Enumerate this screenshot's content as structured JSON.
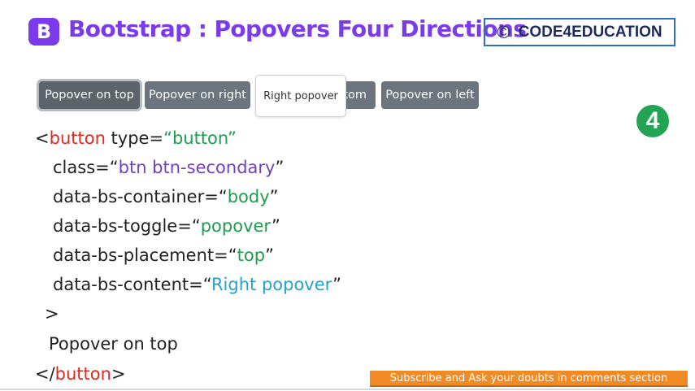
{
  "header": {
    "logo_letter": "B",
    "title": "Bootstrap : Popovers Four Directions",
    "brand": {
      "symbol": "©",
      "name": "CODE4EDUCATION"
    }
  },
  "buttons": [
    {
      "label": "Popover on top"
    },
    {
      "label": "Popover on right"
    },
    {
      "label": "Popover on bottom"
    },
    {
      "label": "Popover on left"
    }
  ],
  "popover": {
    "text": "Right popover"
  },
  "watermark": {
    "glyph": "4"
  },
  "code": {
    "open_lt": "<",
    "open_tag": "button",
    "type_attr": " type=",
    "type_val": "“button”",
    "class_attr": "class=",
    "class_q1": "“",
    "class_val": "btn btn-secondary",
    "class_q2": "”",
    "container_attr": "data-bs-container=",
    "container_q1": "“",
    "container_val": "body",
    "container_q2": "”",
    "toggle_attr": "data-bs-toggle=",
    "toggle_q1": "“",
    "toggle_val": "popover",
    "toggle_q2": "”",
    "placement_attr": "data-bs-placement=",
    "placement_q1": "“",
    "placement_val": "top",
    "placement_q2": "”",
    "content_attr": "data-bs-content=",
    "content_q1": "“",
    "content_val": "Right popover",
    "content_q2": "”",
    "gt": ">",
    "inner_text": "Popover on top",
    "close_lt": "</",
    "close_tag": "button",
    "close_gt": ">"
  },
  "footer": {
    "subscribe": "Subscribe and Ask your doubts in comments section"
  },
  "colors": {
    "title": "#7c3aed",
    "button": "#6c757d",
    "tag": "#e02a1f",
    "value": "#1f9c4d",
    "class_value": "#6f42c1",
    "content_value": "#2a9fc9",
    "banner": "#f08a24"
  }
}
